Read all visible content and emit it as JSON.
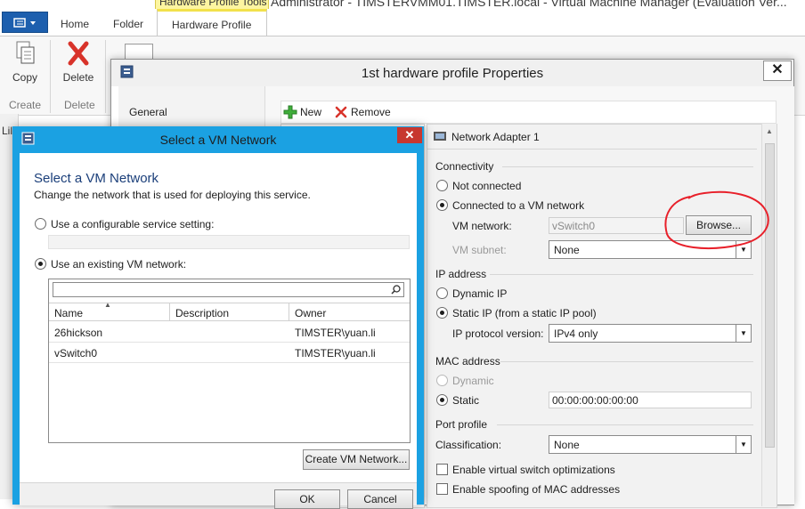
{
  "app": {
    "window_title": "Administrator - TIMSTERVMM01.TIMSTER.local - Virtual Machine Manager (Evaluation Ver...",
    "contextual_tab_group": "Hardware Profile Tools",
    "tabs": [
      "Home",
      "Folder",
      "Hardware Profile"
    ],
    "ribbon": {
      "copy_label": "Copy",
      "delete_label": "Delete",
      "groups": [
        "Create",
        "Delete"
      ]
    },
    "left_fragment": "Lil"
  },
  "properties": {
    "title": "1st hardware profile Properties",
    "close_glyph": "✕",
    "nav_general": "General",
    "toolbar": {
      "new_label": "New",
      "remove_label": "Remove"
    },
    "hardware_item": "Network Adapter 1",
    "connectivity": {
      "heading": "Connectivity",
      "not_connected": "Not connected",
      "connected_vm_network": "Connected to a VM network",
      "vm_network_label": "VM network:",
      "vm_network_value": "vSwitch0",
      "browse_label": "Browse...",
      "vm_subnet_label": "VM subnet:",
      "vm_subnet_value": "None"
    },
    "ip_address": {
      "heading": "IP address",
      "dynamic": "Dynamic IP",
      "static": "Static IP (from a static IP pool)",
      "protocol_label": "IP protocol version:",
      "protocol_value": "IPv4 only"
    },
    "mac_address": {
      "heading": "MAC address",
      "dynamic": "Dynamic",
      "static": "Static",
      "static_value": "00:00:00:00:00:00"
    },
    "port_profile": {
      "heading": "Port profile",
      "classification_label": "Classification:",
      "classification_value": "None",
      "vswitch_opt": "Enable virtual switch optimizations",
      "mac_spoof": "Enable spoofing of MAC addresses"
    },
    "annotation_color": "#e8202a"
  },
  "vm_dialog": {
    "title": "Select a VM Network",
    "close_glyph": "✕",
    "heading": "Select a VM Network",
    "subheading": "Change the network that is used for deploying this service.",
    "option_configurable": "Use a configurable service setting:",
    "option_existing": "Use an existing VM network:",
    "search_placeholder": "",
    "columns": [
      "Name",
      "Description",
      "Owner"
    ],
    "rows": [
      {
        "name": "26hickson",
        "description": "",
        "owner": "TIMSTER\\yuan.li"
      },
      {
        "name": "vSwitch0",
        "description": "",
        "owner": "TIMSTER\\yuan.li"
      }
    ],
    "create_button": "Create VM Network...",
    "ok_label": "OK",
    "cancel_label": "Cancel",
    "accent_color": "#1ba1e2"
  }
}
